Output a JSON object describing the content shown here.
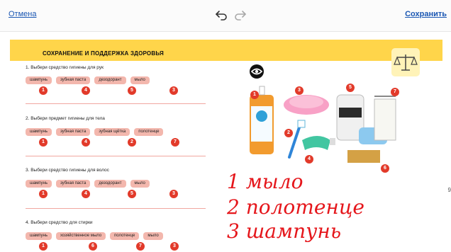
{
  "topbar": {
    "cancel_label": "Отмена",
    "save_label": "Сохранить",
    "undo_icon": "undo-icon",
    "redo_icon": "redo-icon"
  },
  "worksheet": {
    "title": "СОХРАНЕНИЕ И ПОДДЕРЖКА ЗДОРОВЬЯ",
    "questions": [
      {
        "text": "1. Выбери средство гигиены для рук",
        "options": [
          "шампунь",
          "зубная паста",
          "дезодорант",
          "мыло"
        ],
        "numbers": [
          "1",
          "4",
          "5",
          "3"
        ]
      },
      {
        "text": "2. Выбери предмет гигиены для тела",
        "options": [
          "шампунь",
          "зубная паста",
          "зубная щётка",
          "полотенце"
        ],
        "numbers": [
          "1",
          "4",
          "2",
          "7"
        ]
      },
      {
        "text": "3. Выбери средство гигиены для волос",
        "options": [
          "шампунь",
          "зубная паста",
          "дезодорант",
          "мыло"
        ],
        "numbers": [
          "1",
          "4",
          "5",
          "3"
        ]
      },
      {
        "text": "4. Выбери средство для стирки",
        "options": [
          "шампунь",
          "хозяйственное мыло",
          "полотенце",
          "мыло"
        ],
        "numbers": [
          "1",
          "6",
          "7",
          "3"
        ]
      }
    ],
    "picture_labels": [
      "1",
      "2",
      "3",
      "4",
      "5",
      "6",
      "7"
    ],
    "handwriting": [
      "1 мыло",
      "2 полотенце",
      "3 шампунь"
    ],
    "right_edge_digit": "9",
    "colors": {
      "banner": "#ffd54a",
      "chip": "#f3b7ad",
      "badge": "#e23a2a",
      "ink": "#e5161b"
    },
    "icons": [
      "eye-icon",
      "scales-icon",
      "shampoo-bottle",
      "toothbrush",
      "soap-dish",
      "toothpaste",
      "deodorant",
      "soap-bar",
      "laundry-soap",
      "towel"
    ]
  }
}
